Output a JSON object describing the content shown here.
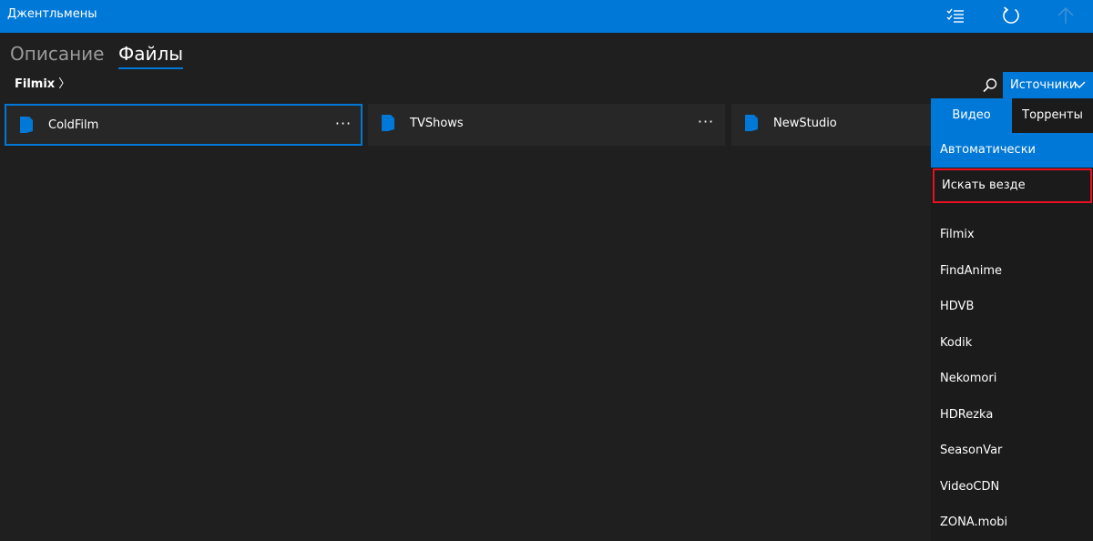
{
  "app": {
    "title": "Джентльмены"
  },
  "titlebar_icons": [
    "checklist-icon",
    "refresh-icon",
    "arrow-up-icon"
  ],
  "tabs": [
    {
      "label": "Описание",
      "active": false
    },
    {
      "label": "Файлы",
      "active": true
    }
  ],
  "breadcrumb": {
    "current": "Filmix",
    "chevron": "〉"
  },
  "sources": {
    "button_label": "Источники",
    "segments": [
      {
        "label": "Видео",
        "selected": true
      },
      {
        "label": "Торренты",
        "selected": false
      }
    ],
    "auto_label": "Автоматически",
    "search_all_label": "Искать везде",
    "items": [
      "Filmix",
      "FindAnime",
      "HDVB",
      "Kodik",
      "Nekomori",
      "HDRezka",
      "SeasonVar",
      "VideoCDN",
      "ZONA.mobi"
    ]
  },
  "folders": [
    {
      "name": "ColdFilm",
      "more": "···",
      "selected": true
    },
    {
      "name": "TVShows",
      "more": "···",
      "selected": false
    },
    {
      "name": "NewStudio",
      "more": "",
      "selected": false
    }
  ],
  "colors": {
    "accent": "#0078d7",
    "background": "#1f1f1f",
    "highlight_border": "#e81123"
  }
}
